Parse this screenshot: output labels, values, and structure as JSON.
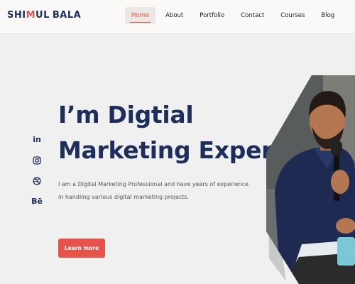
{
  "brand": {
    "name_part1": "SHI",
    "name_m": "M",
    "name_part2": "UL",
    "name_part3": "BALA"
  },
  "nav": {
    "items": [
      {
        "label": "Home",
        "active": true
      },
      {
        "label": "About"
      },
      {
        "label": "Portfolio"
      },
      {
        "label": "Contact"
      },
      {
        "label": "Courses"
      },
      {
        "label": "Blog"
      }
    ]
  },
  "social": [
    {
      "icon": "linkedin-icon",
      "label": "in"
    },
    {
      "icon": "instagram-icon"
    },
    {
      "icon": "dribbble-icon"
    },
    {
      "icon": "behance-icon",
      "label": "Bē"
    }
  ],
  "hero": {
    "headline_line1": "I’m Digtial",
    "headline_line2": "Marketing Expert",
    "description": "I am a Digital Marketing Professional and have years of experience in handling various digital marketing projects.",
    "cta_label": "Learn more",
    "photo_icon": "person-speaking-photo"
  },
  "colors": {
    "accent": "#e5534b",
    "navy": "#1d2d5c",
    "background": "#f0f0f0"
  }
}
